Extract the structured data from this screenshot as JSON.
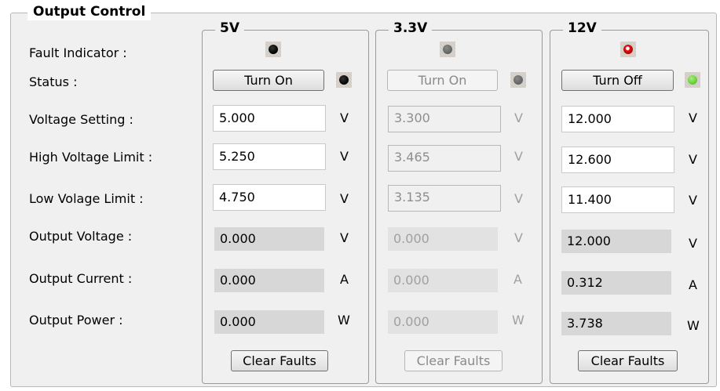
{
  "panel": {
    "title": "Output Control"
  },
  "labels": {
    "fault_indicator": "Fault Indicator :",
    "status": "Status :",
    "voltage_setting": "Voltage Setting  :",
    "high_voltage_limit": "High Voltage Limit  :",
    "low_voltage_limit": "Low Volage Limit :",
    "output_voltage": "Output Voltage :",
    "output_current": "Output Current :",
    "output_power": "Output Power :"
  },
  "units": {
    "volt": "V",
    "amp": "A",
    "watt": "W"
  },
  "channels": [
    {
      "name": "5V",
      "enabled": true,
      "fault_led": "black",
      "status_led": "black",
      "toggle_label": "Turn On",
      "voltage_setting": "5.000",
      "high_limit": "5.250",
      "low_limit": "4.750",
      "output_voltage": "0.000",
      "output_current": "0.000",
      "output_power": "0.000",
      "clear_label": "Clear Faults"
    },
    {
      "name": "3.3V",
      "enabled": false,
      "fault_led": "gray",
      "status_led": "gray",
      "toggle_label": "Turn On",
      "voltage_setting": "3.300",
      "high_limit": "3.465",
      "low_limit": "3.135",
      "output_voltage": "0.000",
      "output_current": "0.000",
      "output_power": "0.000",
      "clear_label": "Clear Faults"
    },
    {
      "name": "12V",
      "enabled": true,
      "fault_led": "red",
      "status_led": "green",
      "toggle_label": "Turn Off",
      "voltage_setting": "12.000",
      "high_limit": "12.600",
      "low_limit": "11.400",
      "output_voltage": "12.000",
      "output_current": "0.312",
      "output_power": "3.738",
      "clear_label": "Clear Faults"
    }
  ],
  "colors": {
    "panel_bg": "#f0f0f0",
    "readout_bg": "#d7d7d7",
    "led_fault_12v": "#e01010",
    "led_status_12v": "#5cc92e"
  }
}
